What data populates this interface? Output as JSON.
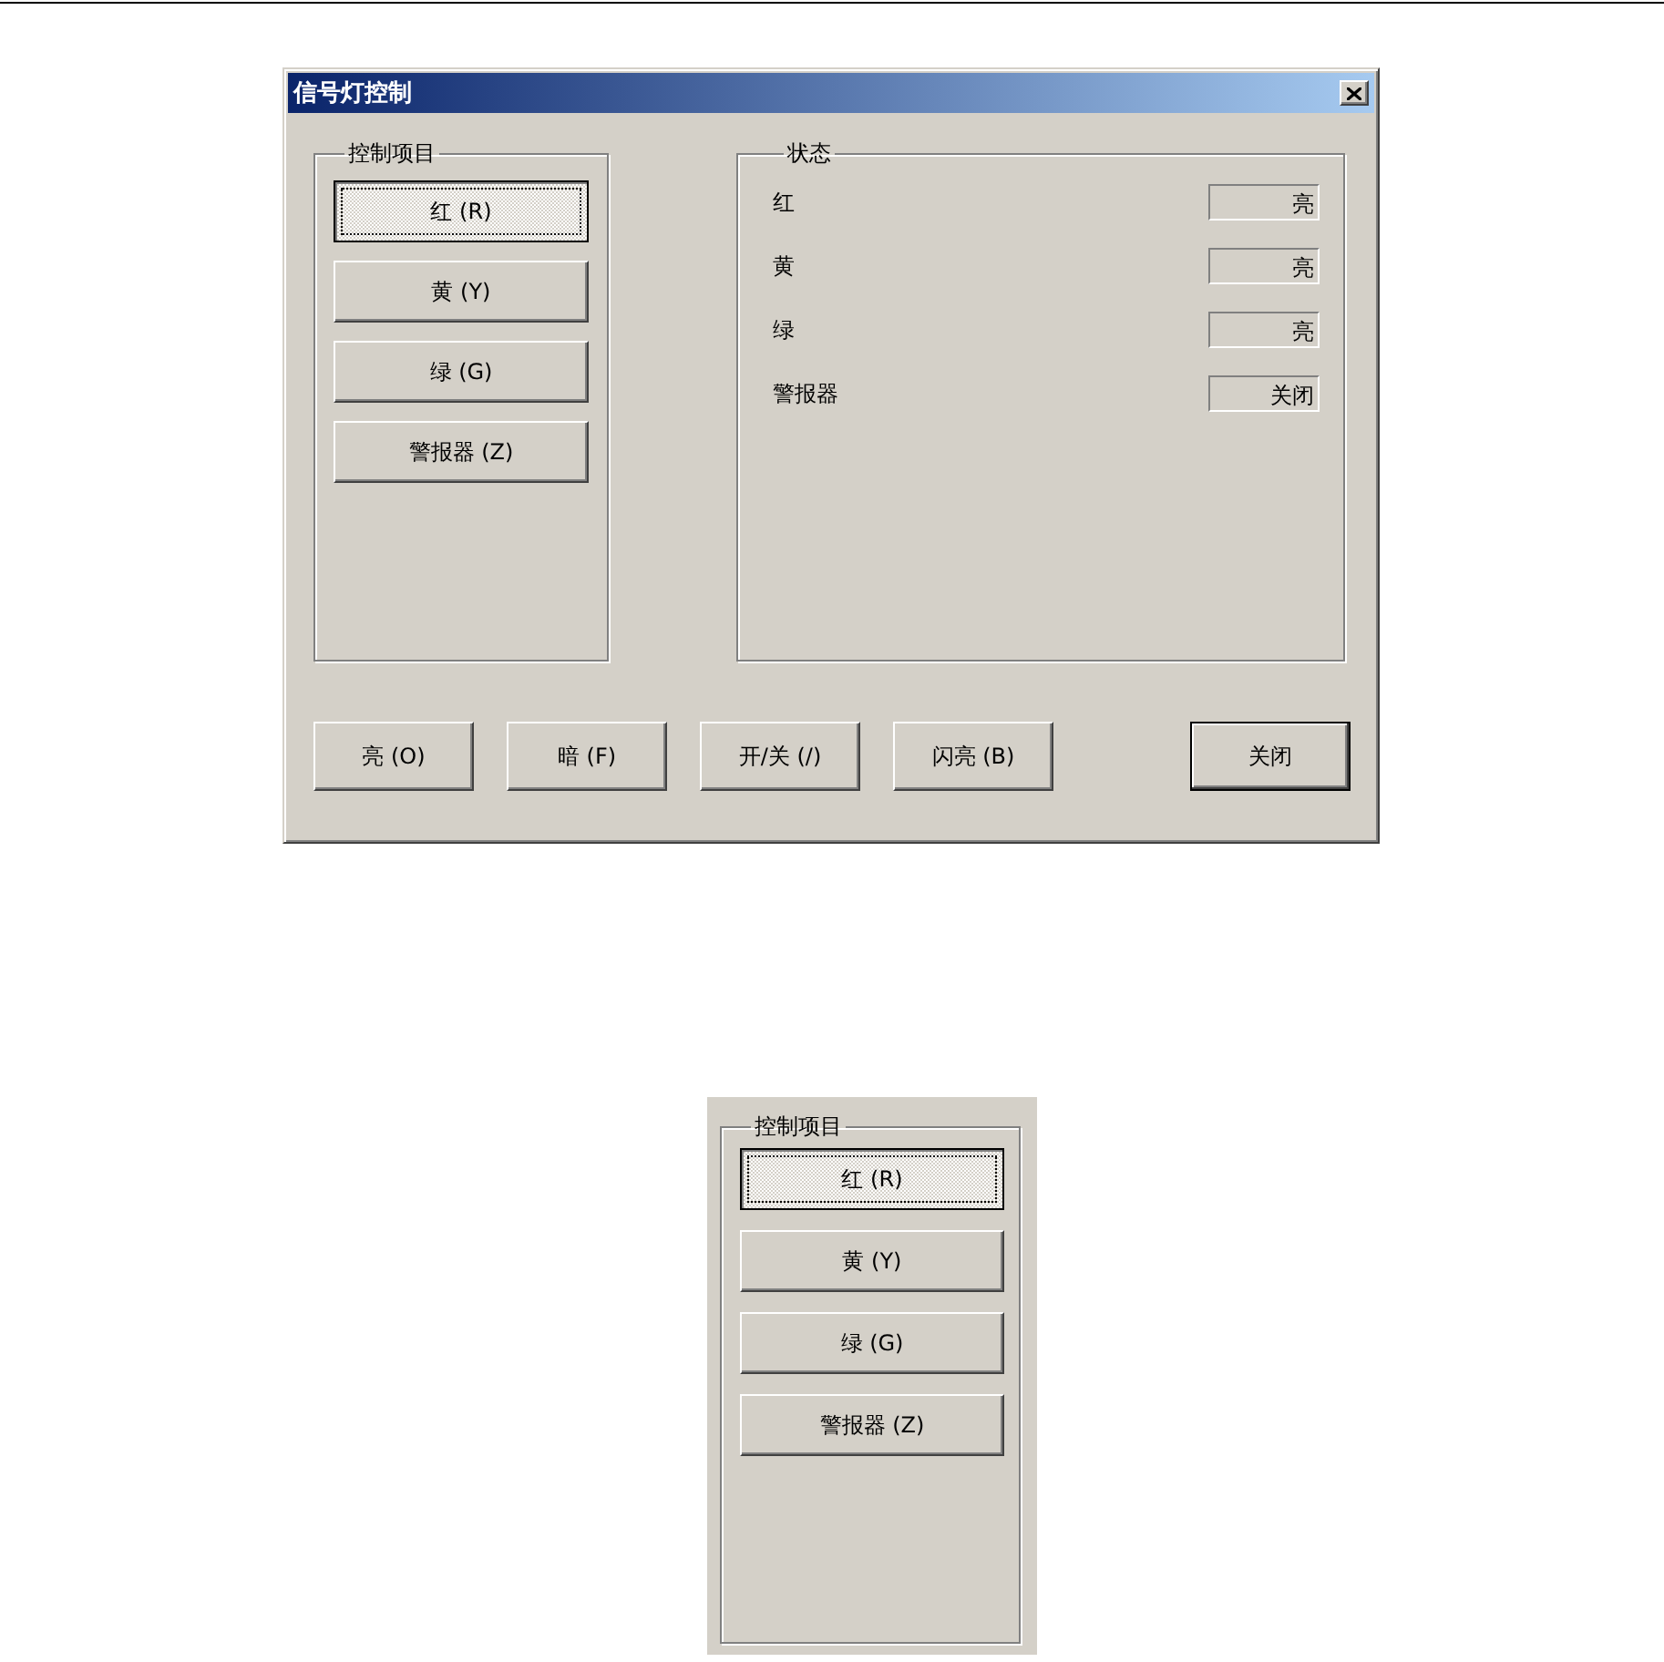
{
  "dialog": {
    "title": "信号灯控制",
    "control_group": {
      "title": "控制项目",
      "buttons": [
        {
          "label": "红 (R)",
          "selected": true
        },
        {
          "label": "黄 (Y)",
          "selected": false
        },
        {
          "label": "绿 (G)",
          "selected": false
        },
        {
          "label": "警报器 (Z)",
          "selected": false
        }
      ]
    },
    "status_group": {
      "title": "状态",
      "rows": [
        {
          "label": "红",
          "value": "亮"
        },
        {
          "label": "黄",
          "value": "亮"
        },
        {
          "label": "绿",
          "value": "亮"
        },
        {
          "label": "警报器",
          "value": "关闭"
        }
      ]
    },
    "buttons": [
      {
        "label": "亮 (O)",
        "default": false
      },
      {
        "label": "暗 (F)",
        "default": false
      },
      {
        "label": "开/关 (/)",
        "default": false
      },
      {
        "label": "闪亮 (B)",
        "default": false
      },
      {
        "label": "关闭",
        "default": true
      }
    ]
  },
  "detail_panel": {
    "title": "控制项目",
    "buttons": [
      {
        "label": "红 (R)",
        "selected": true
      },
      {
        "label": "黄 (Y)",
        "selected": false
      },
      {
        "label": "绿 (G)",
        "selected": false
      },
      {
        "label": "警报器 (Z)",
        "selected": false
      }
    ]
  }
}
